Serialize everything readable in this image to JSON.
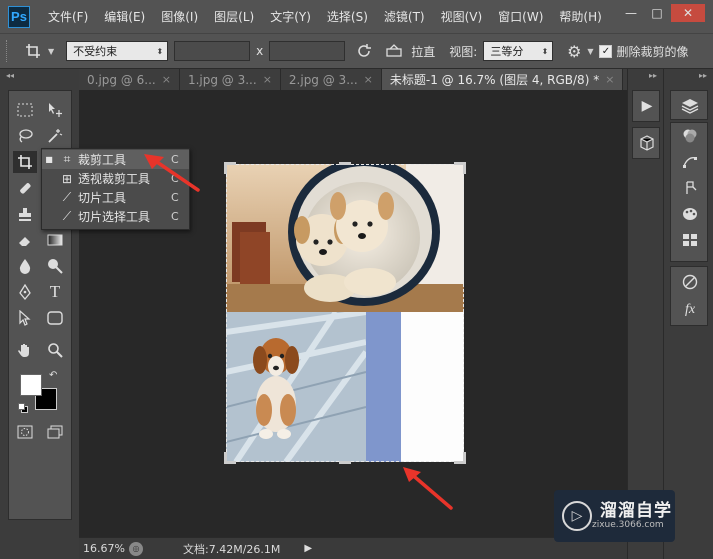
{
  "app": {
    "logo": "Ps",
    "menu": [
      "文件(F)",
      "编辑(E)",
      "图像(I)",
      "图层(L)",
      "文字(Y)",
      "选择(S)",
      "滤镜(T)",
      "视图(V)",
      "窗口(W)",
      "帮助(H)"
    ],
    "window_controls": [
      "—",
      "□",
      "✕"
    ]
  },
  "options_bar": {
    "ratio_preset": "不受约束",
    "ratio_separator": "x",
    "straighten_label": "拉直",
    "view_label": "视图:",
    "view_value": "三等分",
    "delete_cropped_checked": true,
    "delete_cropped_label": "删除裁剪的像"
  },
  "tabs": [
    {
      "label": "0.jpg @ 6...",
      "active": false
    },
    {
      "label": "1.jpg @ 3...",
      "active": false
    },
    {
      "label": "2.jpg @ 3...",
      "active": false
    },
    {
      "label": "未标题-1 @ 16.7% (图层 4, RGB/8) *",
      "active": true
    }
  ],
  "tab_close_glyph": "×",
  "flyout": {
    "items": [
      {
        "label": "裁剪工具",
        "key": "C",
        "icon": "crop-icon",
        "selected": true
      },
      {
        "label": "透视裁剪工具",
        "key": "C",
        "icon": "perspective-crop-icon",
        "selected": false
      },
      {
        "label": "切片工具",
        "key": "C",
        "icon": "slice-icon",
        "selected": false
      },
      {
        "label": "切片选择工具",
        "key": "C",
        "icon": "slice-select-icon",
        "selected": false
      }
    ]
  },
  "status": {
    "zoom": "16.67%",
    "doc_info": "文档:7.42M/26.1M"
  },
  "watermark": {
    "title": "溜溜自学",
    "subtitle": "zixue.3066.com"
  },
  "colors": {
    "accent_arrow": "#e8342a",
    "foreground_swatch": "#ffffff",
    "background_swatch": "#000000"
  }
}
